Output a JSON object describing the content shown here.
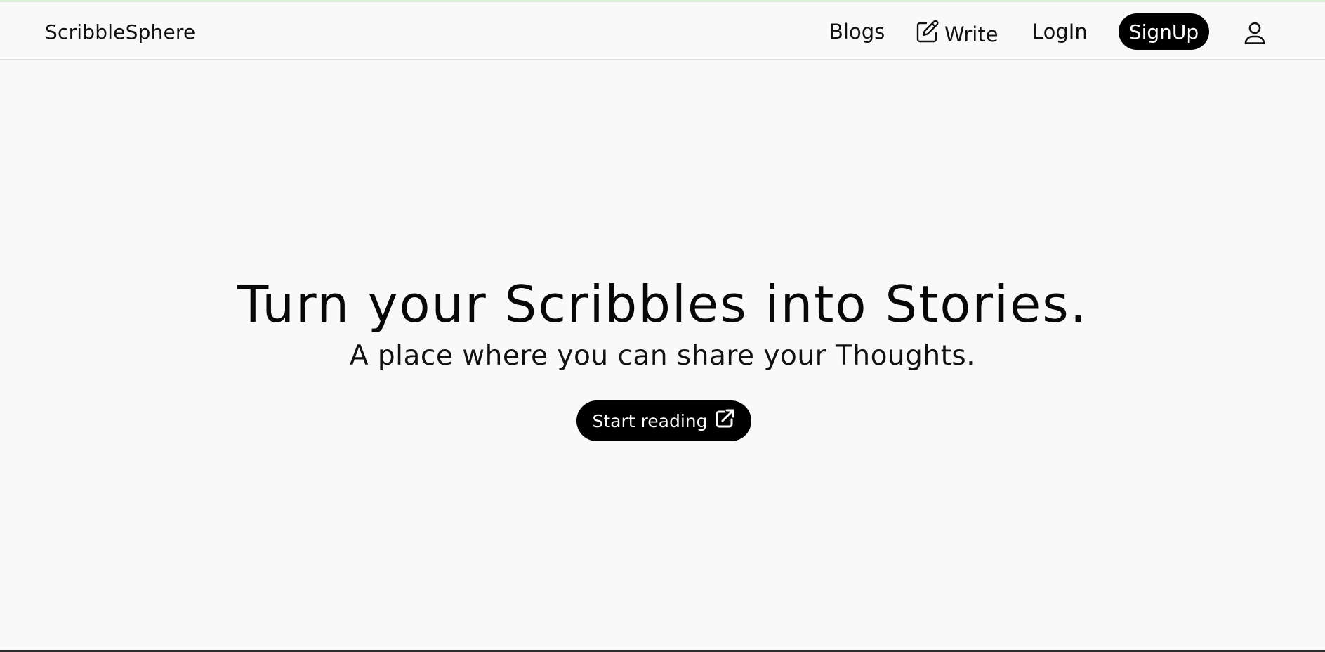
{
  "brand": {
    "name": "ScribbleSphere"
  },
  "nav": {
    "blogs": "Blogs",
    "write": "Write",
    "login": "LogIn",
    "signup": "SignUp",
    "icons": {
      "write": "pencil-square-icon",
      "user": "user-icon"
    }
  },
  "hero": {
    "title": "Turn your Scribbles into Stories.",
    "subtitle": "A place where you can share your Thoughts.",
    "cta": "Start reading",
    "cta_icon": "external-link-icon"
  },
  "colors": {
    "background": "#f9f9f9",
    "button": "#000000",
    "button_text": "#ffffff",
    "text": "#0a0a0a",
    "top_accent": "#d9ecd6"
  }
}
